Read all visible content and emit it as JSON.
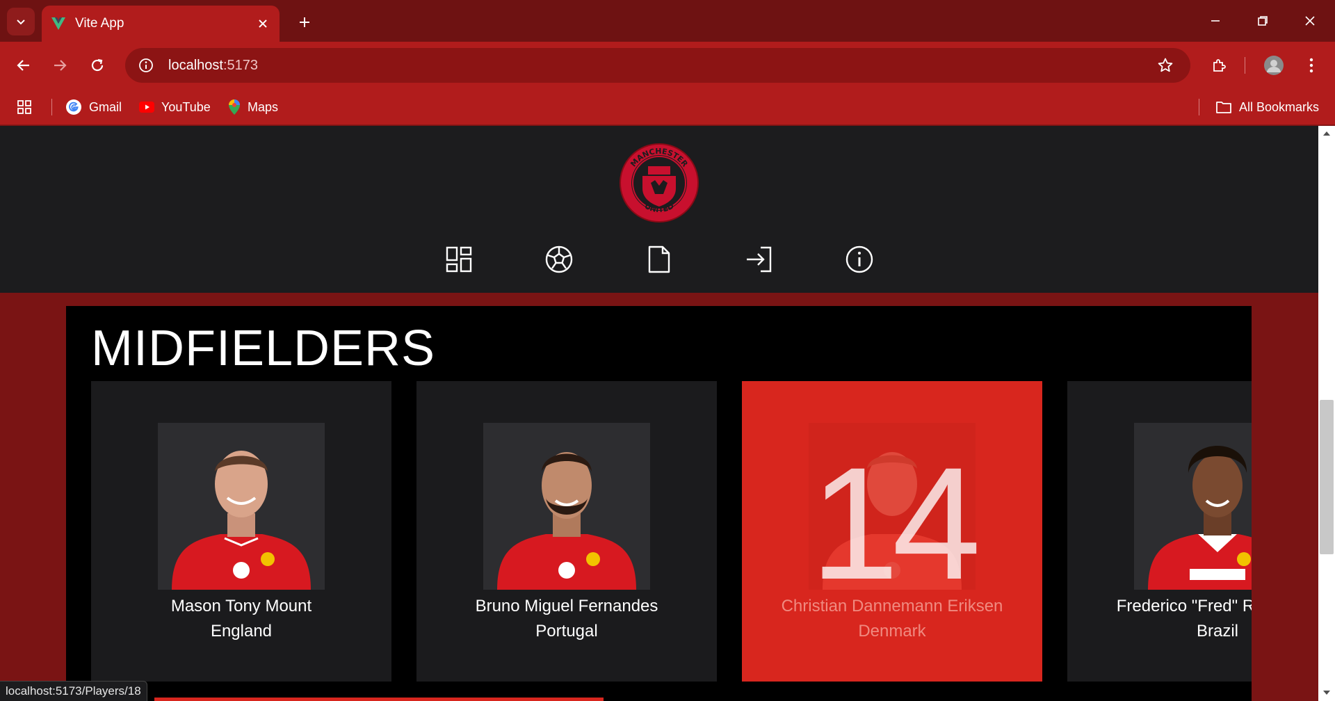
{
  "browser": {
    "tab_title": "Vite App",
    "url_host": "localhost",
    "url_port": ":5173",
    "bookmarks": [
      {
        "label": "Gmail",
        "icon": "gmail-icon"
      },
      {
        "label": "YouTube",
        "icon": "youtube-icon"
      },
      {
        "label": "Maps",
        "icon": "maps-icon"
      }
    ],
    "all_bookmarks_label": "All Bookmarks",
    "status_url": "localhost:5173/Players/18"
  },
  "site": {
    "crest_text_top": "MANCHESTER",
    "crest_text_bottom": "UNITED",
    "nav_icons": [
      "dashboard-icon",
      "football-icon",
      "document-icon",
      "login-icon",
      "info-icon"
    ]
  },
  "section": {
    "title": "MIDFIELDERS",
    "players": [
      {
        "name": "Mason Tony Mount",
        "nation": "England",
        "number": "",
        "active": false
      },
      {
        "name": "Bruno Miguel Fernandes",
        "nation": "Portugal",
        "number": "",
        "active": false
      },
      {
        "name": "Christian Dannemann Eriksen",
        "nation": "Denmark",
        "number": "14",
        "active": true
      },
      {
        "name": "Frederico \"Fred\" Rodrigues",
        "nation": "Brazil",
        "number": "",
        "active": false
      }
    ]
  },
  "colors": {
    "brand_red": "#d8261e",
    "chrome_red": "#b11c1c",
    "header_dark": "#1c1c1e"
  }
}
